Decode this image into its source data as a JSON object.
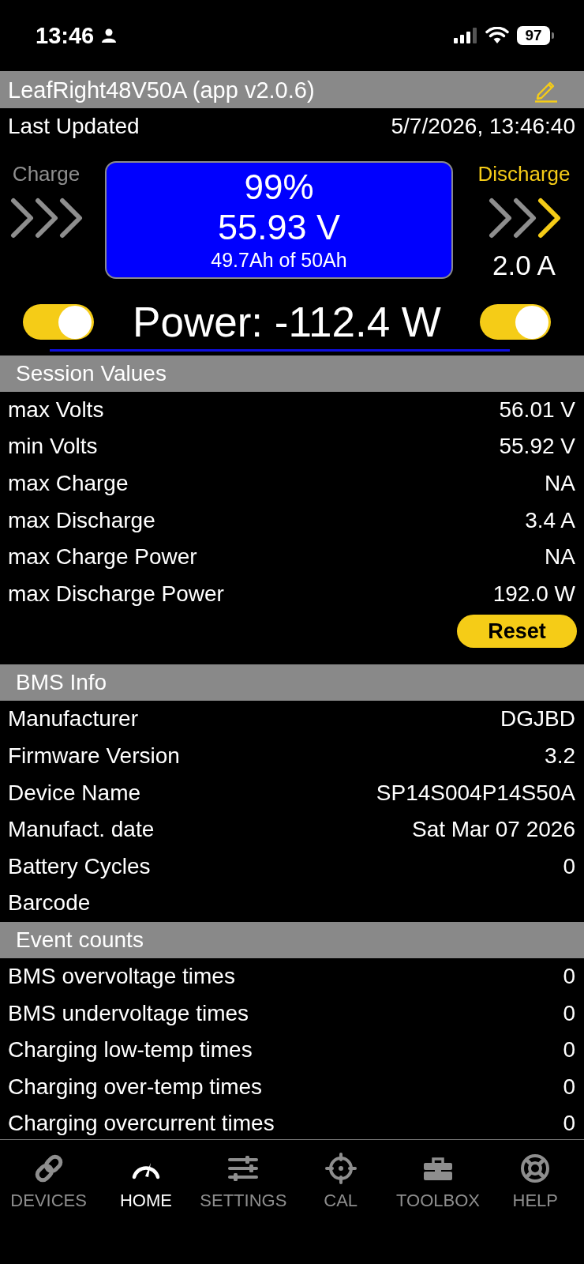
{
  "status_bar": {
    "time": "13:46",
    "battery": "97"
  },
  "header": {
    "title": "LeafRight48V50A (app v2.0.6)"
  },
  "last_updated": {
    "label": "Last Updated",
    "value": "5/7/2026, 13:46:40"
  },
  "battery": {
    "charge": {
      "label": "Charge",
      "active": false,
      "chevrons": [
        {
          "lit": false
        },
        {
          "lit": false
        },
        {
          "lit": false
        }
      ]
    },
    "display": {
      "percent": "99%",
      "voltage": "55.93 V",
      "capacity": "49.7Ah of 50Ah"
    },
    "discharge": {
      "label": "Discharge",
      "active": true,
      "chevrons": [
        {
          "lit": false
        },
        {
          "lit": false
        },
        {
          "lit": true
        }
      ],
      "current": "2.0 A"
    }
  },
  "power": {
    "text": "Power: -112.4 W",
    "charge_switch": {
      "on": true
    },
    "discharge_switch": {
      "on": true
    }
  },
  "sections": [
    {
      "title": "Session Values",
      "rows": [
        {
          "label": "max Volts",
          "value": "56.01 V"
        },
        {
          "label": "min Volts",
          "value": "55.92 V"
        },
        {
          "label": "max Charge",
          "value": "NA"
        },
        {
          "label": "max Discharge",
          "value": "3.4 A"
        },
        {
          "label": "max Charge Power",
          "value": "NA"
        },
        {
          "label": "max Discharge Power",
          "value": "192.0 W"
        }
      ],
      "button": "Reset"
    },
    {
      "title": "BMS Info",
      "rows": [
        {
          "label": "Manufacturer",
          "value": "DGJBD"
        },
        {
          "label": "Firmware Version",
          "value": "3.2"
        },
        {
          "label": "Device Name",
          "value": "SP14S004P14S50A"
        },
        {
          "label": "Manufact. date",
          "value": "Sat Mar 07 2026"
        },
        {
          "label": "Battery Cycles",
          "value": "0"
        },
        {
          "label": "Barcode"
        }
      ]
    },
    {
      "title": "Event counts",
      "rows": [
        {
          "label": "BMS overvoltage times",
          "value": "0"
        },
        {
          "label": "BMS undervoltage times",
          "value": "0"
        },
        {
          "label": "Charging low-temp times",
          "value": "0"
        },
        {
          "label": "Charging over-temp times",
          "value": "0"
        },
        {
          "label": "Charging overcurrent times",
          "value": "0"
        }
      ]
    }
  ],
  "tab_bar": [
    {
      "label": "DEVICES",
      "selected": false
    },
    {
      "label": "HOME",
      "selected": true
    },
    {
      "label": "SETTINGS",
      "selected": false
    },
    {
      "label": "CAL",
      "selected": false
    },
    {
      "label": "TOOLBOX",
      "selected": false
    },
    {
      "label": "HELP",
      "selected": false
    }
  ]
}
